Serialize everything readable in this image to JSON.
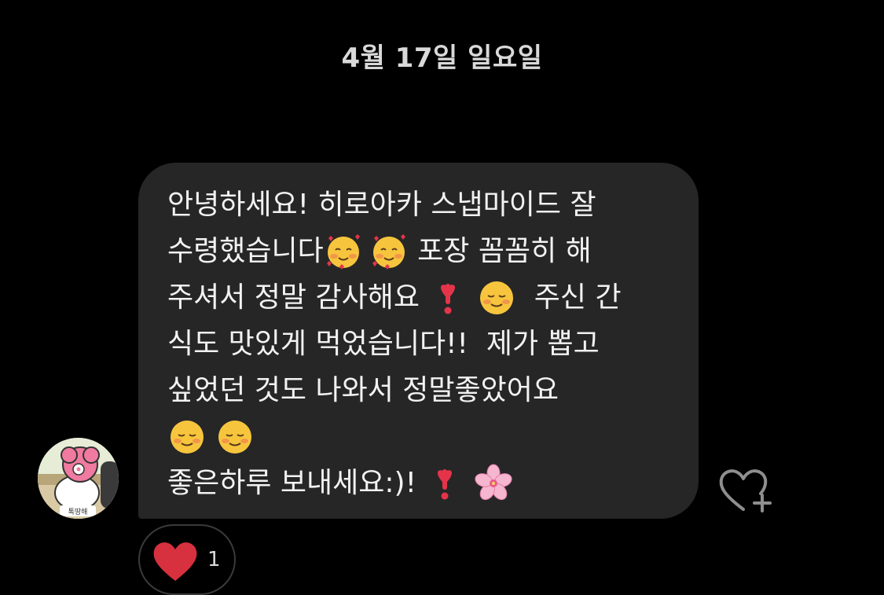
{
  "date_header": "4월 17일 일요일",
  "avatar": {
    "icon": "character-avatar-icon",
    "caption": "톡땅해"
  },
  "message": {
    "lines": [
      {
        "segments": [
          {
            "text": "안녕하세요! 히로아카 스냅마이드 잘"
          }
        ]
      },
      {
        "segments": [
          {
            "text": "수령했습니다"
          },
          {
            "emoji": "smiling-face-with-hearts-icon"
          },
          {
            "emoji": "smiling-face-with-hearts-icon"
          },
          {
            "text": " 포장 꼼꼼히 해"
          }
        ]
      },
      {
        "segments": [
          {
            "text": "주셔서 정말 감사해요 "
          },
          {
            "emoji": "heart-exclamation-icon"
          },
          {
            "text": " "
          },
          {
            "emoji": "smiling-face-icon"
          },
          {
            "text": "  주신 간"
          }
        ]
      },
      {
        "segments": [
          {
            "text": "식도 맛있게 먹었습니다!!  제가 뽑고"
          }
        ]
      },
      {
        "segments": [
          {
            "text": "싶었던 것도 나와서 정말좋았어요"
          }
        ]
      },
      {
        "segments": [
          {
            "emoji": "smiling-face-icon"
          },
          {
            "text": " "
          },
          {
            "emoji": "smiling-face-icon"
          }
        ]
      },
      {
        "segments": [
          {
            "text": "좋은하루 보내세요:)! "
          },
          {
            "emoji": "heart-exclamation-icon"
          },
          {
            "text": " "
          },
          {
            "emoji": "cherry-blossom-icon"
          }
        ]
      }
    ]
  },
  "like_button": {
    "icon": "heart-plus-icon"
  },
  "reaction": {
    "icon": "red-heart-icon",
    "count": "1"
  },
  "colors": {
    "background": "#000000",
    "bubble": "#262626",
    "text": "#f2f2f2",
    "heart": "#d7303f"
  }
}
